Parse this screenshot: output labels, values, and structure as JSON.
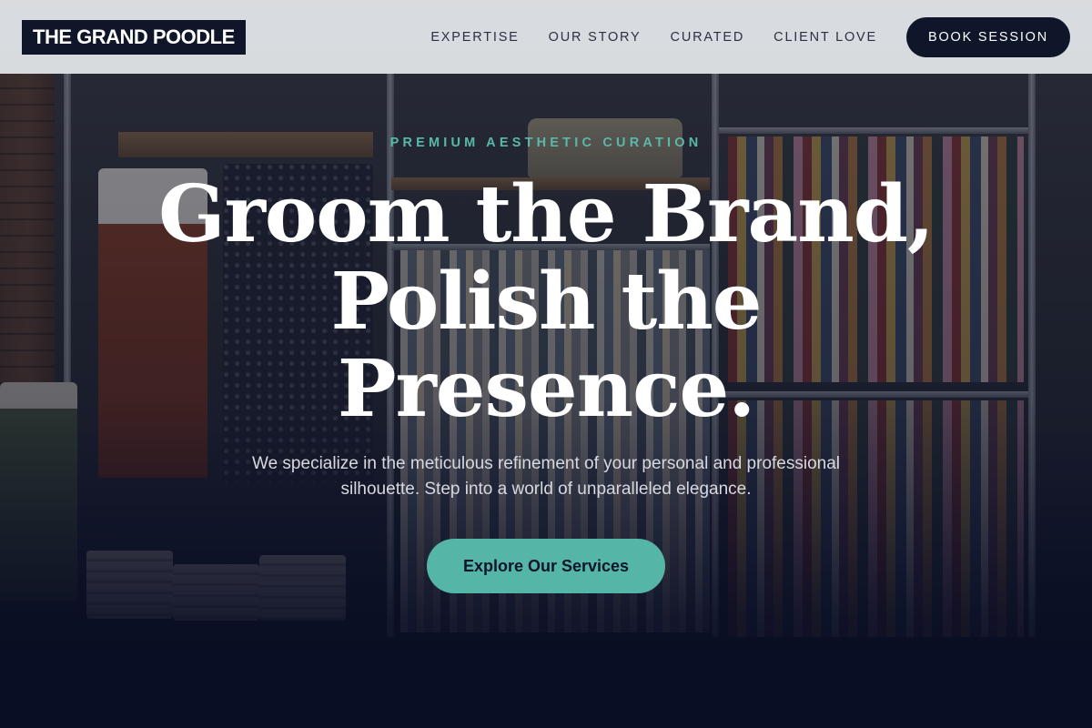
{
  "brand": {
    "logo_text": "THE GRAND POODLE"
  },
  "nav": {
    "links": [
      "EXPERTISE",
      "OUR STORY",
      "CURATED",
      "CLIENT LOVE"
    ],
    "cta_label": "BOOK SESSION"
  },
  "hero": {
    "eyebrow": "PREMIUM AESTHETIC CURATION",
    "headline_lines": [
      "Groom the Brand,",
      "Polish the",
      "Presence."
    ],
    "subtext": "We specialize in the meticulous refinement of your personal and professional silhouette. Step into a world of unparalleled elegance.",
    "cta_label": "Explore Our Services",
    "background_image": "clothing-boutique-racks"
  },
  "colors": {
    "header_bg": "#e6e8ec",
    "navy": "#0f1629",
    "accent_teal": "#55b5a6",
    "hero_dark": "#0b1024"
  }
}
